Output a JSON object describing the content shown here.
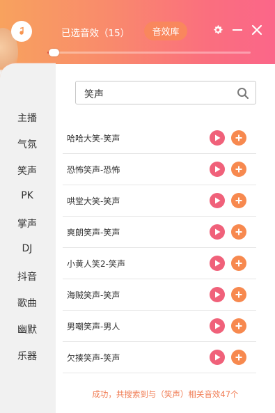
{
  "header": {
    "selected_label": "已选音效（15）",
    "library_button": "音效库",
    "progress": 0.03
  },
  "sidebar": {
    "items": [
      {
        "label": "主播"
      },
      {
        "label": "气氛"
      },
      {
        "label": "笑声"
      },
      {
        "label": "PK"
      },
      {
        "label": "掌声"
      },
      {
        "label": "DJ"
      },
      {
        "label": "抖音"
      },
      {
        "label": "歌曲"
      },
      {
        "label": "幽默"
      },
      {
        "label": "乐器"
      }
    ]
  },
  "search": {
    "value": "笑声",
    "icon": "search-icon"
  },
  "results": [
    {
      "name": "哈哈大笑-笑声"
    },
    {
      "name": "恐怖笑声-恐怖"
    },
    {
      "name": "哄堂大笑-笑声"
    },
    {
      "name": "爽朗笑声-笑声"
    },
    {
      "name": "小黄人笑2-笑声"
    },
    {
      "name": "海贼笑声-笑声"
    },
    {
      "name": "男嘲笑声-男人"
    },
    {
      "name": "欠揍笑声-笑声"
    }
  ],
  "status_text": "成功，共搜索到与（笑声）相关音效47个",
  "colors": {
    "header_start": "#f8a25e",
    "header_end": "#fb6689",
    "play": "#f0617a",
    "add": "#f7894f",
    "status": "#f07b52"
  }
}
